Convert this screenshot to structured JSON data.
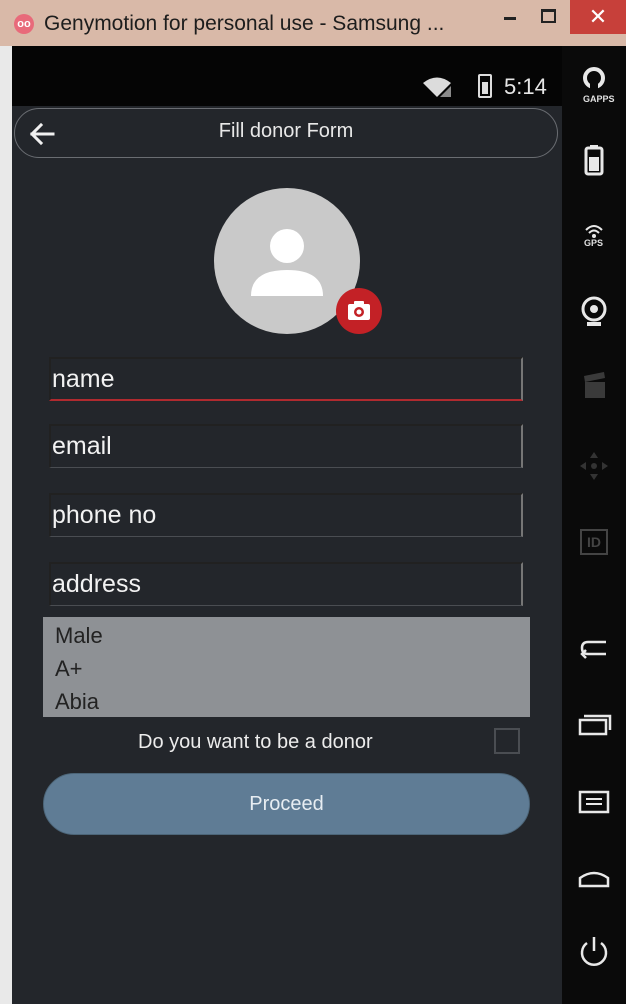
{
  "window": {
    "title": "Genymotion for personal use - Samsung ...",
    "close_glyph": "✕",
    "logo_glyph": "oo"
  },
  "status_bar": {
    "time": "5:14"
  },
  "action_bar": {
    "title": "Fill donor Form"
  },
  "form": {
    "name_placeholder": "name",
    "email_placeholder": "email",
    "phone_placeholder": "phone no",
    "address_placeholder": "address",
    "gender_value": "Male",
    "blood_group_value": "A+",
    "state_value": "Abia",
    "donor_question": "Do you want to be a donor",
    "donor_checked": false,
    "proceed_label": "Proceed"
  },
  "sidebar": {
    "gapps_label": "GAPPS",
    "gps_label": "GPS",
    "id_label": "ID"
  },
  "colors": {
    "accent_red": "#c32126",
    "button_blue": "#5f7c95",
    "background": "#23262b"
  }
}
